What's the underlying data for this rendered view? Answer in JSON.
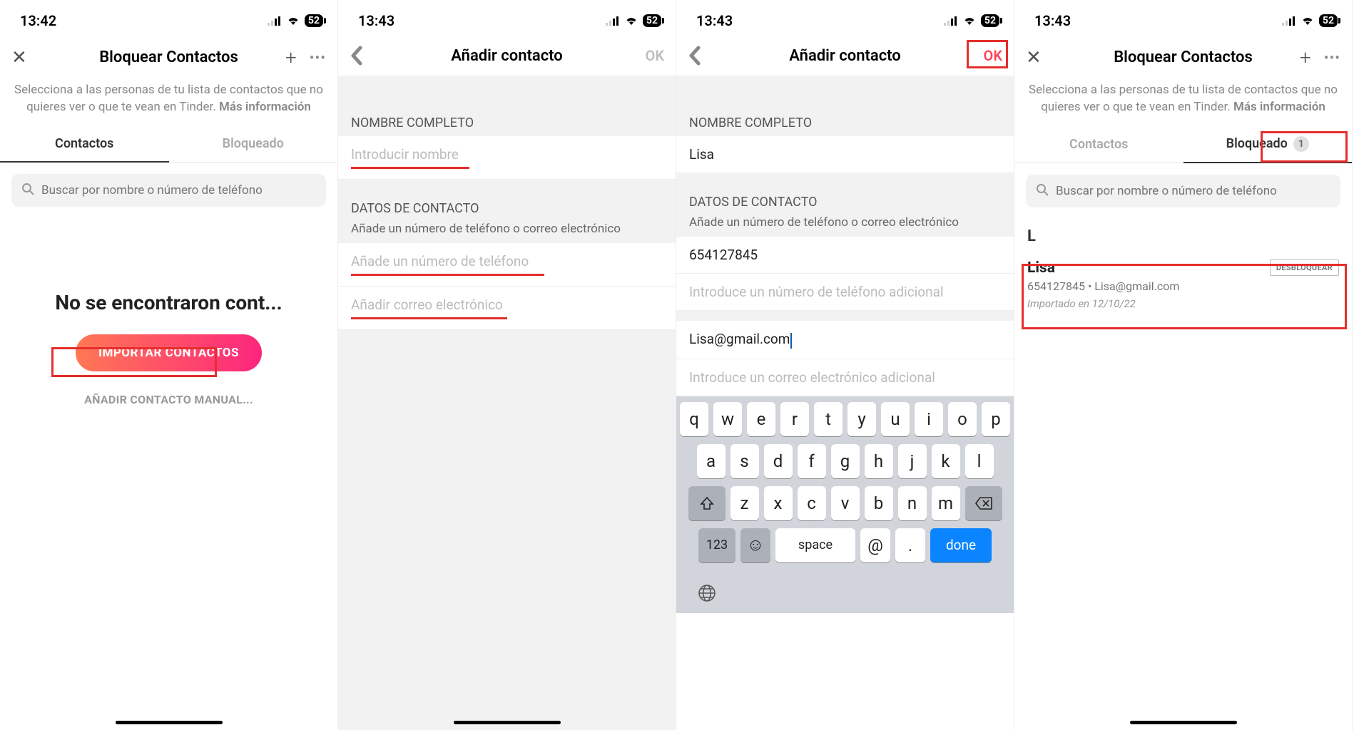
{
  "status": {
    "time1": "13:42",
    "time2": "13:43",
    "battery": "52"
  },
  "screen1": {
    "title": "Bloquear Contactos",
    "info_pre": "Selecciona a las personas de tu lista de contactos que no quieres ver o que te vean en Tinder. ",
    "info_bold": "Más información",
    "tab_contacts": "Contactos",
    "tab_blocked": "Bloqueado",
    "search_ph": "Buscar por nombre o número de teléfono",
    "empty_title": "No se encontraron cont...",
    "import_btn": "IMPORTAR CONTACTOS",
    "manual_btn": "AÑADIR CONTACTO MANUAL..."
  },
  "screen2": {
    "title": "Añadir contacto",
    "ok": "OK",
    "sec_name": "NOMBRE COMPLETO",
    "ph_name": "Introducir nombre",
    "sec_contact": "DATOS DE CONTACTO",
    "sub_contact": "Añade un número de teléfono o correo electrónico",
    "ph_phone": "Añade un número de teléfono",
    "ph_email": "Añadir correo electrónico"
  },
  "screen3": {
    "title": "Añadir contacto",
    "ok": "OK",
    "sec_name": "NOMBRE COMPLETO",
    "val_name": "Lisa",
    "sec_contact": "DATOS DE CONTACTO",
    "sub_contact": "Añade un número de teléfono o correo electrónico",
    "val_phone": "654127845",
    "ph_phone2": "Introduce un número de teléfono adicional",
    "val_email": "Lisa@gmail.com",
    "ph_email2": "Introduce un correo electrónico adicional",
    "kb": {
      "row1": [
        "q",
        "w",
        "e",
        "r",
        "t",
        "y",
        "u",
        "i",
        "o",
        "p"
      ],
      "row2": [
        "a",
        "s",
        "d",
        "f",
        "g",
        "h",
        "j",
        "k",
        "l"
      ],
      "row3": [
        "z",
        "x",
        "c",
        "v",
        "b",
        "n",
        "m"
      ],
      "num": "123",
      "space": "space",
      "at": "@",
      "dot": ".",
      "done": "done"
    }
  },
  "screen4": {
    "title": "Bloquear Contactos",
    "info_pre": "Selecciona a las personas de tu lista de contactos que no quieres ver o que te vean en Tinder. ",
    "info_bold": "Más información",
    "tab_contacts": "Contactos",
    "tab_blocked": "Bloqueado",
    "badge": "1",
    "search_ph": "Buscar por nombre o número de teléfono",
    "letter": "L",
    "contact": {
      "name": "Lisa",
      "unblock": "DESBLOQUEAR",
      "details": "654127845  •  Lisa@gmail.com",
      "meta": "Importado en 12/10/22"
    }
  }
}
